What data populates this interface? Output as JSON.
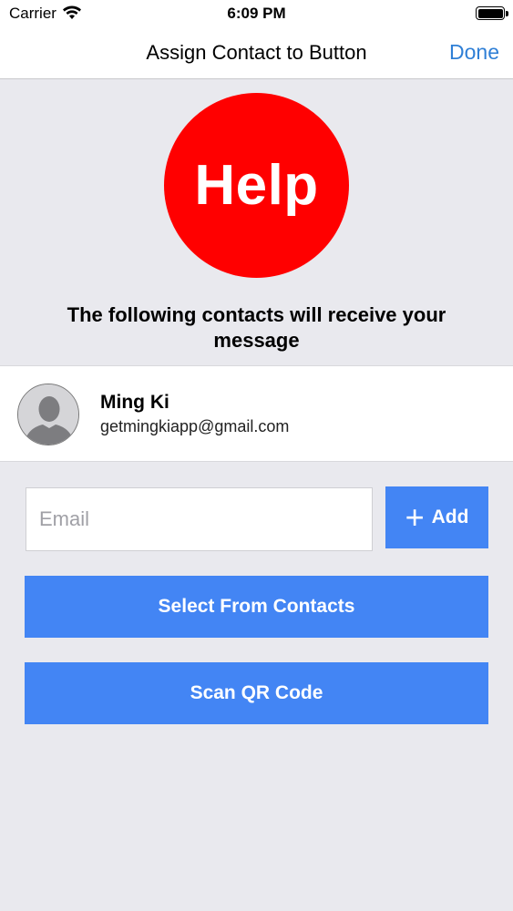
{
  "status_bar": {
    "carrier": "Carrier",
    "time": "6:09 PM"
  },
  "nav": {
    "title": "Assign Contact to Button",
    "done_label": "Done"
  },
  "help_button": {
    "label": "Help",
    "color": "#ff0000"
  },
  "info_text": "The following contacts will receive your message",
  "contact": {
    "name": "Ming Ki",
    "email": "getmingkiapp@gmail.com",
    "avatar_icon": "person-silhouette-icon"
  },
  "email_field": {
    "placeholder": "Email",
    "value": ""
  },
  "add_button": {
    "label": "Add",
    "icon": "plus-icon"
  },
  "select_contacts_button": {
    "label": "Select From Contacts"
  },
  "scan_qr_button": {
    "label": "Scan QR Code"
  },
  "colors": {
    "accent": "#4385f4",
    "nav_link": "#2f7fd6",
    "background": "#e9e9ee"
  }
}
